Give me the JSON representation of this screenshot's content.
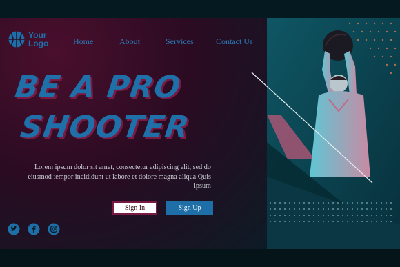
{
  "logo": {
    "line1": "Your",
    "line2": "Logo",
    "icon": "basketball-icon"
  },
  "nav": {
    "items": [
      {
        "label": "Home"
      },
      {
        "label": "About"
      },
      {
        "label": "Services"
      },
      {
        "label": "Contact Us"
      }
    ]
  },
  "hero": {
    "headline_line1": "BE A PRO",
    "headline_line2": "SHOOTER",
    "description": "Lorem ipsum dolor sit amet, consectetur adipiscing elit, sed do eiusmod tempor incididunt ut labore et dolore magna aliqua Quis ipsum",
    "signin_label": "Sign In",
    "signup_label": "Sign Up"
  },
  "socials": [
    {
      "name": "twitter-icon"
    },
    {
      "name": "facebook-icon"
    },
    {
      "name": "instagram-icon"
    }
  ],
  "colors": {
    "accent_blue": "#1e6fa8",
    "accent_magenta": "#7a1a43",
    "background_dark": "#041419"
  }
}
